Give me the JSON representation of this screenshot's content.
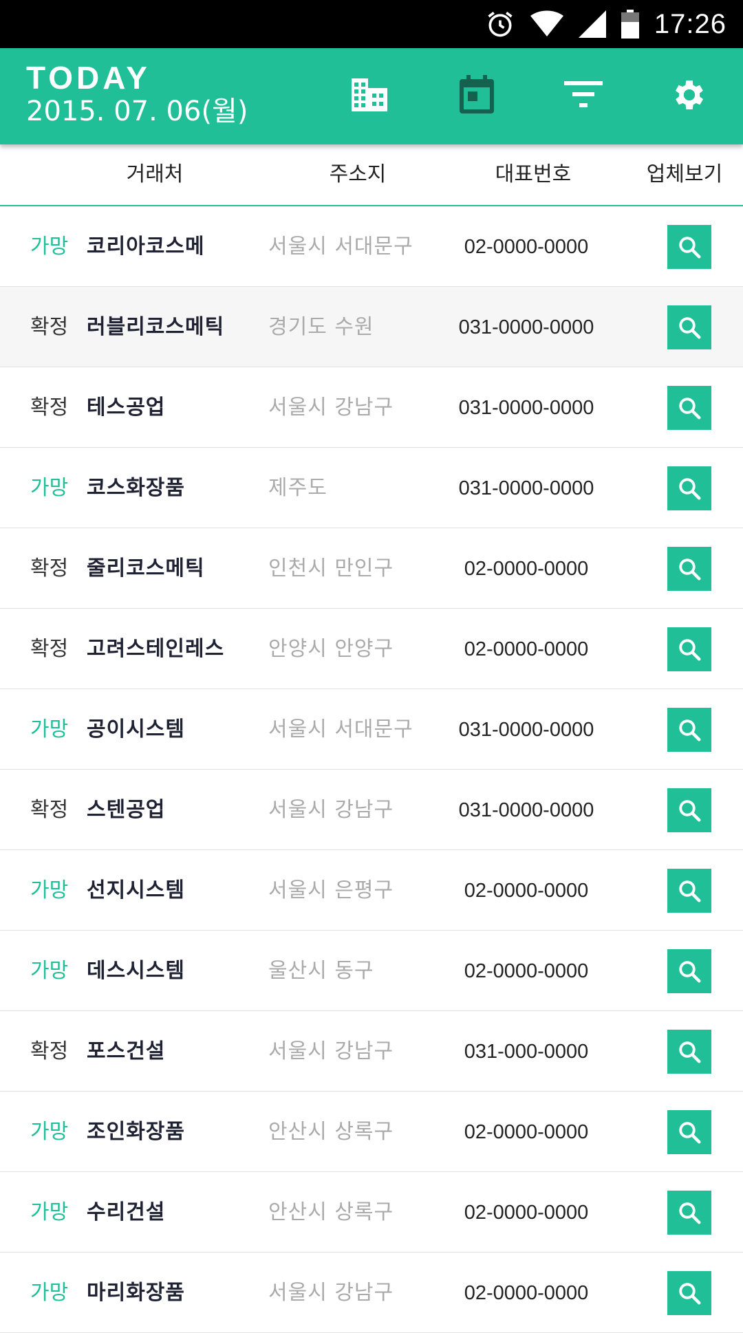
{
  "statusbar": {
    "time": "17:26"
  },
  "appbar": {
    "title": "TODAY",
    "date": "2015. 07. 06(월)",
    "accent": "#21bf98",
    "icons": [
      "building-icon",
      "calendar-icon",
      "filter-icon",
      "gear-icon"
    ]
  },
  "columns": {
    "company": "거래처",
    "address": "주소지",
    "phone": "대표번호",
    "view": "업체보기"
  },
  "rows": [
    {
      "status": "가망",
      "status_type": "pending",
      "company": "코리아코스메",
      "address": "서울시 서대문구",
      "phone": "02-0000-0000"
    },
    {
      "status": "확정",
      "status_type": "confirmed",
      "company": "러블리코스메틱",
      "address": "경기도 수원",
      "phone": "031-0000-0000"
    },
    {
      "status": "확정",
      "status_type": "confirmed",
      "company": "테스공업",
      "address": "서울시 강남구",
      "phone": "031-0000-0000"
    },
    {
      "status": "가망",
      "status_type": "pending",
      "company": "코스화장품",
      "address": "제주도",
      "phone": "031-0000-0000"
    },
    {
      "status": "확정",
      "status_type": "confirmed",
      "company": "줄리코스메틱",
      "address": "인천시 만인구",
      "phone": "02-0000-0000"
    },
    {
      "status": "확정",
      "status_type": "confirmed",
      "company": "고려스테인레스",
      "address": "안양시 안양구",
      "phone": "02-0000-0000"
    },
    {
      "status": "가망",
      "status_type": "pending",
      "company": "공이시스템",
      "address": "서울시 서대문구",
      "phone": "031-0000-0000"
    },
    {
      "status": "확정",
      "status_type": "confirmed",
      "company": "스텐공업",
      "address": "서울시 강남구",
      "phone": "031-0000-0000"
    },
    {
      "status": "가망",
      "status_type": "pending",
      "company": "선지시스템",
      "address": "서울시 은평구",
      "phone": "02-0000-0000"
    },
    {
      "status": "가망",
      "status_type": "pending",
      "company": "데스시스템",
      "address": "울산시 동구",
      "phone": "02-0000-0000"
    },
    {
      "status": "확정",
      "status_type": "confirmed",
      "company": "포스건설",
      "address": "서울시 강남구",
      "phone": "031-000-0000"
    },
    {
      "status": "가망",
      "status_type": "pending",
      "company": "조인화장품",
      "address": "안산시 상록구",
      "phone": "02-0000-0000"
    },
    {
      "status": "가망",
      "status_type": "pending",
      "company": "수리건설",
      "address": "안산시 상록구",
      "phone": "02-0000-0000"
    },
    {
      "status": "가망",
      "status_type": "pending",
      "company": "마리화장품",
      "address": "서울시 강남구",
      "phone": "02-0000-0000"
    }
  ]
}
